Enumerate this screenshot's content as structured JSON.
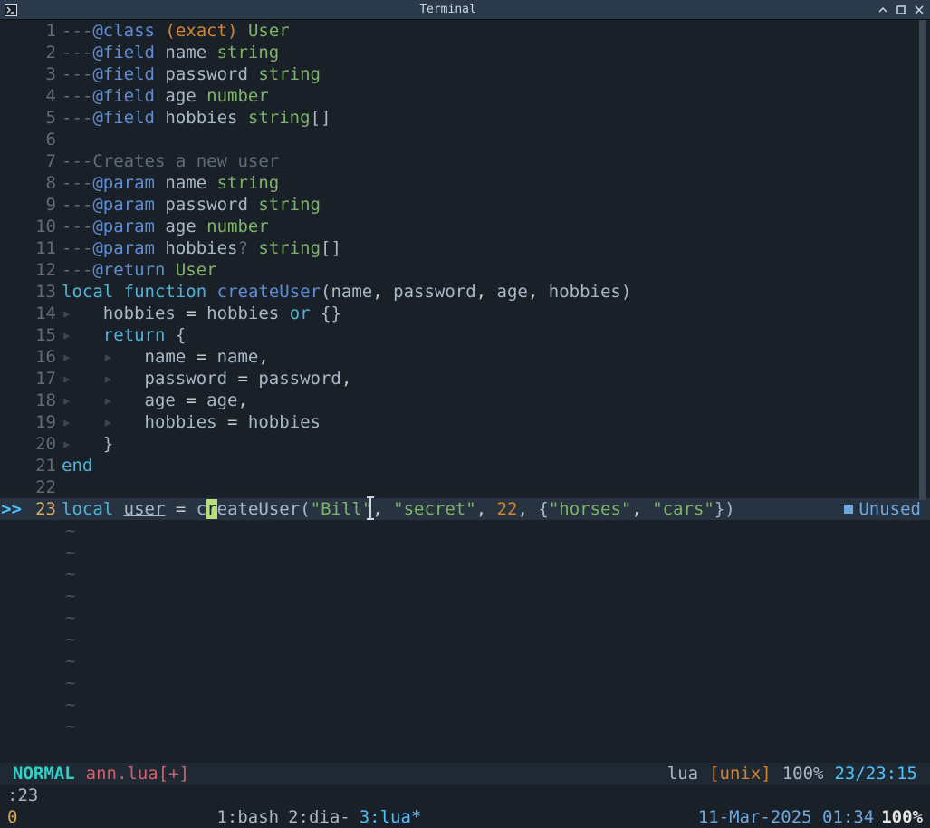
{
  "window": {
    "title": "Terminal"
  },
  "editor": {
    "current_line_sign": ">>",
    "lines": [
      {
        "n": 1,
        "tokens": [
          [
            "c-dim",
            "---"
          ],
          [
            "c-ann",
            "@class"
          ],
          [
            "c-name",
            " "
          ],
          [
            "c-paren-orange",
            "(exact)"
          ],
          [
            "c-name",
            " "
          ],
          [
            "c-type-green",
            "User"
          ]
        ]
      },
      {
        "n": 2,
        "tokens": [
          [
            "c-dim",
            "---"
          ],
          [
            "c-ann",
            "@field"
          ],
          [
            "c-name",
            " name "
          ],
          [
            "c-type-green",
            "string"
          ]
        ]
      },
      {
        "n": 3,
        "tokens": [
          [
            "c-dim",
            "---"
          ],
          [
            "c-ann",
            "@field"
          ],
          [
            "c-name",
            " password "
          ],
          [
            "c-type-green",
            "string"
          ]
        ]
      },
      {
        "n": 4,
        "tokens": [
          [
            "c-dim",
            "---"
          ],
          [
            "c-ann",
            "@field"
          ],
          [
            "c-name",
            " age "
          ],
          [
            "c-type-green",
            "number"
          ]
        ]
      },
      {
        "n": 5,
        "tokens": [
          [
            "c-dim",
            "---"
          ],
          [
            "c-ann",
            "@field"
          ],
          [
            "c-name",
            " hobbies "
          ],
          [
            "c-type-green",
            "string"
          ],
          [
            "c-brackets",
            "[]"
          ]
        ]
      },
      {
        "n": 6,
        "tokens": []
      },
      {
        "n": 7,
        "tokens": [
          [
            "c-dim",
            "---"
          ],
          [
            "c-comment",
            "Creates a new user"
          ]
        ]
      },
      {
        "n": 8,
        "tokens": [
          [
            "c-dim",
            "---"
          ],
          [
            "c-ann",
            "@param"
          ],
          [
            "c-name",
            " name "
          ],
          [
            "c-type-green",
            "string"
          ]
        ]
      },
      {
        "n": 9,
        "tokens": [
          [
            "c-dim",
            "---"
          ],
          [
            "c-ann",
            "@param"
          ],
          [
            "c-name",
            " password "
          ],
          [
            "c-type-green",
            "string"
          ]
        ]
      },
      {
        "n": 10,
        "tokens": [
          [
            "c-dim",
            "---"
          ],
          [
            "c-ann",
            "@param"
          ],
          [
            "c-name",
            " age "
          ],
          [
            "c-type-green",
            "number"
          ]
        ]
      },
      {
        "n": 11,
        "tokens": [
          [
            "c-dim",
            "---"
          ],
          [
            "c-ann",
            "@param"
          ],
          [
            "c-name",
            " hobbies"
          ],
          [
            "c-dim",
            "?"
          ],
          [
            "c-name",
            " "
          ],
          [
            "c-type-green",
            "string"
          ],
          [
            "c-brackets",
            "[]"
          ]
        ]
      },
      {
        "n": 12,
        "tokens": [
          [
            "c-dim",
            "---"
          ],
          [
            "c-ann",
            "@return"
          ],
          [
            "c-name",
            " "
          ],
          [
            "c-type-green",
            "User"
          ]
        ]
      },
      {
        "n": 13,
        "tokens": [
          [
            "c-kw",
            "local"
          ],
          [
            "c-name",
            " "
          ],
          [
            "c-kw",
            "function"
          ],
          [
            "c-name",
            " "
          ],
          [
            "c-fn",
            "createUser"
          ],
          [
            "c-brackets",
            "("
          ],
          [
            "c-name",
            "name"
          ],
          [
            "c-op",
            ", "
          ],
          [
            "c-name",
            "password"
          ],
          [
            "c-op",
            ", "
          ],
          [
            "c-name",
            "age"
          ],
          [
            "c-op",
            ", "
          ],
          [
            "c-name",
            "hobbies"
          ],
          [
            "c-brackets",
            ")"
          ]
        ]
      },
      {
        "n": 14,
        "tokens": [
          [
            "c-indent",
            "▸   "
          ],
          [
            "c-name",
            "hobbies "
          ],
          [
            "c-op",
            "= "
          ],
          [
            "c-name",
            "hobbies "
          ],
          [
            "c-kw",
            "or"
          ],
          [
            "c-name",
            " "
          ],
          [
            "c-brackets",
            "{}"
          ]
        ]
      },
      {
        "n": 15,
        "tokens": [
          [
            "c-indent",
            "▸   "
          ],
          [
            "c-kw",
            "return"
          ],
          [
            "c-name",
            " "
          ],
          [
            "c-brackets",
            "{"
          ]
        ]
      },
      {
        "n": 16,
        "tokens": [
          [
            "c-indent",
            "▸   ▸   "
          ],
          [
            "c-name",
            "name "
          ],
          [
            "c-op",
            "= "
          ],
          [
            "c-name",
            "name"
          ],
          [
            "c-op",
            ","
          ]
        ]
      },
      {
        "n": 17,
        "tokens": [
          [
            "c-indent",
            "▸   ▸   "
          ],
          [
            "c-name",
            "password "
          ],
          [
            "c-op",
            "= "
          ],
          [
            "c-name",
            "password"
          ],
          [
            "c-op",
            ","
          ]
        ]
      },
      {
        "n": 18,
        "tokens": [
          [
            "c-indent",
            "▸   ▸   "
          ],
          [
            "c-name",
            "age "
          ],
          [
            "c-op",
            "= "
          ],
          [
            "c-name",
            "age"
          ],
          [
            "c-op",
            ","
          ]
        ]
      },
      {
        "n": 19,
        "tokens": [
          [
            "c-indent",
            "▸   ▸   "
          ],
          [
            "c-name",
            "hobbies "
          ],
          [
            "c-op",
            "= "
          ],
          [
            "c-name",
            "hobbies"
          ]
        ]
      },
      {
        "n": 20,
        "tokens": [
          [
            "c-indent",
            "▸   "
          ],
          [
            "c-brackets",
            "}"
          ]
        ]
      },
      {
        "n": 21,
        "tokens": [
          [
            "c-kw",
            "end"
          ]
        ]
      },
      {
        "n": 22,
        "tokens": []
      },
      {
        "n": 23,
        "current": true,
        "tokens": [
          [
            "c-kw",
            "local"
          ],
          [
            "c-name",
            " "
          ],
          [
            "c-name c-underline",
            "user"
          ],
          [
            "c-name",
            " "
          ],
          [
            "c-op",
            "= "
          ],
          [
            "c-name",
            "c"
          ],
          [
            "cursor-block",
            "r"
          ],
          [
            "c-name",
            "eateUser"
          ],
          [
            "c-brackets",
            "("
          ],
          [
            "c-str",
            "\"Bill\""
          ],
          [
            "c-op",
            ", "
          ],
          [
            "c-str",
            "\"secret\""
          ],
          [
            "c-op",
            ", "
          ],
          [
            "c-num",
            "22"
          ],
          [
            "c-op",
            ", "
          ],
          [
            "c-brackets",
            "{"
          ],
          [
            "c-str",
            "\"horses\""
          ],
          [
            "c-op",
            ", "
          ],
          [
            "c-str",
            "\"cars\""
          ],
          [
            "c-brackets",
            "})"
          ]
        ],
        "diag": "Unused"
      }
    ],
    "empty_rows": 10
  },
  "status": {
    "mode": "NORMAL",
    "file": "ann.lua[+]",
    "filetype": "lua",
    "encoding": "[unix]",
    "percent": "100%",
    "position": "23/23:15"
  },
  "cmdline": ":23",
  "tmux": {
    "session": "0",
    "windows": [
      {
        "label": "1:bash",
        "active": false
      },
      {
        "label": "2:dia-",
        "active": false
      },
      {
        "label": "3:lua*",
        "active": true
      }
    ],
    "datetime": "11-Mar-2025 01:34",
    "percent": "100%"
  }
}
